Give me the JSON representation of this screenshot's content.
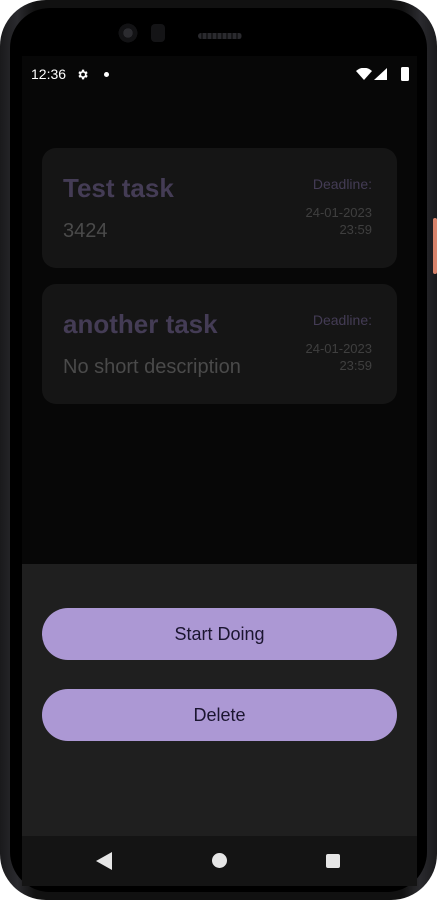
{
  "status_bar": {
    "time": "12:36",
    "icons": [
      "gear-icon",
      "notification-dot-icon",
      "wifi-icon",
      "signal-icon",
      "battery-icon"
    ]
  },
  "tasks": [
    {
      "title": "Test task",
      "description": "3424",
      "deadline_label": "Deadline:",
      "deadline_date": "24-01-2023",
      "deadline_time": "23:59"
    },
    {
      "title": "another task",
      "description": "No short description",
      "deadline_label": "Deadline:",
      "deadline_date": "24-01-2023",
      "deadline_time": "23:59"
    }
  ],
  "action_sheet": {
    "start_label": "Start Doing",
    "delete_label": "Delete"
  },
  "nav_bar": {
    "icons": [
      "back-icon",
      "home-icon",
      "recents-icon"
    ]
  },
  "colors": {
    "accent": "#ac98d4",
    "title_dimmed": "#443c55",
    "sheet_background": "#1f1f1f",
    "screen_background": "#070707"
  }
}
